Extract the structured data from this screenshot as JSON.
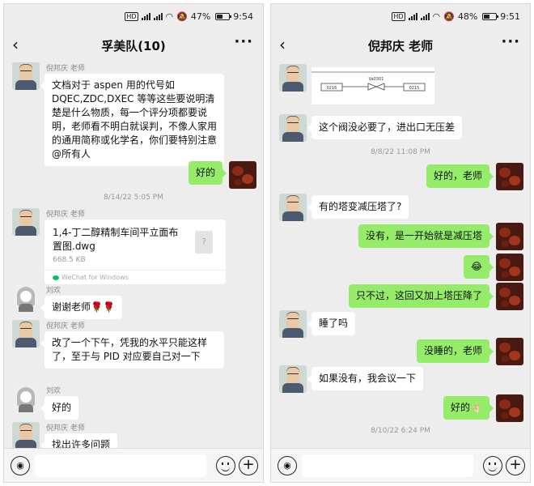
{
  "left": {
    "status": {
      "battery": "47%",
      "time": "9:54",
      "battery_level": 0.47
    },
    "title": "孚美队(10)",
    "messages": {
      "m1": {
        "sender": "倪邦庆 老师",
        "text": "文档对于 aspen 用的代号如DQEC,ZDC,DXEC 等等这些要说明清楚是什么物质，每一个评分项都要说明，老师看不明白就误判，不像人家用的通用简称或化学名，你们要特别注意@所有人"
      },
      "m2": {
        "text": "好的"
      },
      "ts1": "8/14/22 5:05 PM",
      "m3": {
        "sender": "倪邦庆 老师",
        "file_name": "1,4-丁二醇精制车间平立面布置图.dwg",
        "file_size": "668.5 KB",
        "file_source": "WeChat for Windows"
      },
      "m4": {
        "sender": "刘欢",
        "text": "谢谢老师🌹🌹"
      },
      "m5": {
        "sender": "倪邦庆 老师",
        "text": "改了一个下午，凭我的水平只能这样了，至于与 PID 对应要自己对一下"
      },
      "m6": {
        "sender": "刘欢",
        "text": "好的"
      },
      "m7": {
        "sender": "倪邦庆 老师",
        "text": "找出许多问题"
      }
    }
  },
  "right": {
    "status": {
      "battery": "48%",
      "time": "9:51",
      "battery_level": 0.48
    },
    "title": "倪邦庆 老师",
    "messages": {
      "m1": {
        "diagram_left": "0216",
        "diagram_mid": "Va0301",
        "diagram_right": "0215"
      },
      "m2": {
        "text": "这个阀没必要了，进出口无压差"
      },
      "ts1": "8/8/22 11:08 PM",
      "m3": {
        "text": "好的，老师"
      },
      "m4": {
        "text": "有的塔变减压塔了?"
      },
      "m5": {
        "text": "没有，是一开始就是减压塔"
      },
      "m6": {
        "text": "😂"
      },
      "m7": {
        "text": "只不过，这回又加上塔压降了"
      },
      "m8": {
        "text": "睡了吗"
      },
      "m9": {
        "text": "没睡的，老师"
      },
      "m10": {
        "text": "如果没有，我会议一下"
      },
      "m11": {
        "text": "好的👌🏻"
      },
      "ts2": "8/10/22 6:24 PM"
    }
  },
  "colors": {
    "chat_bg": "#ededed",
    "bubble_green": "#95ec69",
    "bubble_white": "#ffffff"
  },
  "icons": [
    "back-icon",
    "more-icon",
    "voice-icon",
    "emoji-icon",
    "plus-icon",
    "file-icon",
    "mute-icon",
    "wifi-icon",
    "signal-icon",
    "battery-icon"
  ]
}
